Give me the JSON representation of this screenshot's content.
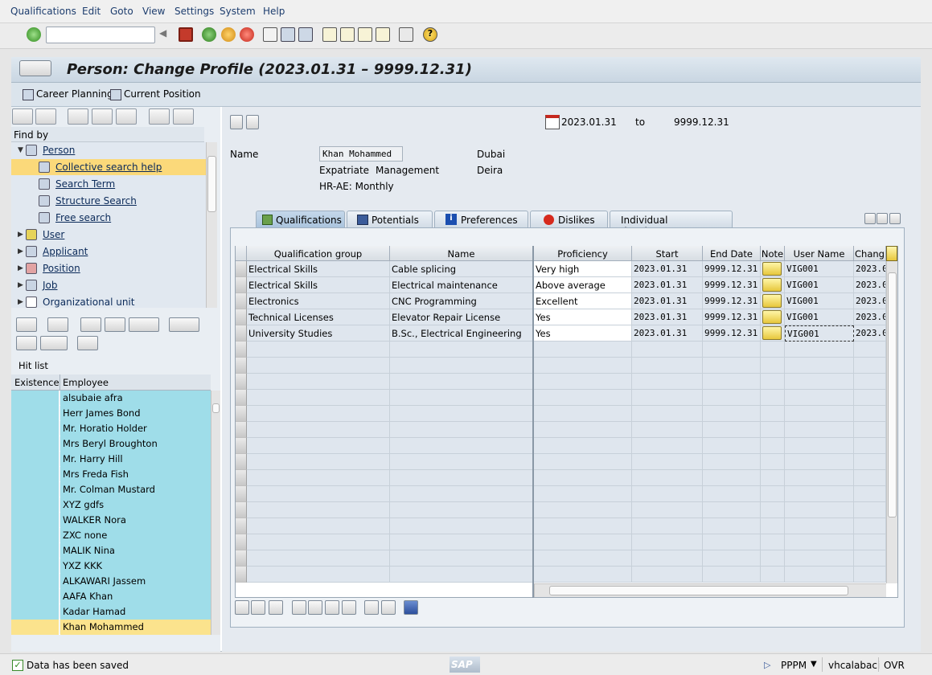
{
  "menu": [
    "Qualifications",
    "Edit",
    "Goto",
    "View",
    "Settings",
    "System",
    "Help"
  ],
  "command_field": {
    "value": "",
    "placeholder": ""
  },
  "title": "Person: Change Profile (2023.01.31 – 9999.12.31)",
  "app_toolbar": {
    "career_planning": "Career Planning",
    "current_position": "Current Position"
  },
  "left": {
    "find_by": "Find by",
    "tree": [
      {
        "label": "Person",
        "level": 0,
        "expanded": true
      },
      {
        "label": "Collective search help",
        "level": 1,
        "selected": true
      },
      {
        "label": "Search Term",
        "level": 1
      },
      {
        "label": "Structure Search",
        "level": 1
      },
      {
        "label": "Free search",
        "level": 1
      },
      {
        "label": "User",
        "level": 0
      },
      {
        "label": "Applicant",
        "level": 0
      },
      {
        "label": "Position",
        "level": 0
      },
      {
        "label": "Job",
        "level": 0
      },
      {
        "label": "Organizational unit",
        "level": 0
      }
    ],
    "hit_list_label": "Hit list",
    "hit_columns": [
      "Existence",
      "Employee"
    ],
    "hits": [
      "alsubaie afra",
      "Herr James Bond",
      "Mr. Horatio Holder",
      "Mrs Beryl Broughton",
      "Mr. Harry Hill",
      "Mrs Freda Fish",
      "Mr. Colman Mustard",
      "XYZ gdfs",
      "WALKER Nora",
      "ZXC none",
      "MALIK Nina",
      "YXZ KKK",
      "ALKAWARI Jassem",
      "AAFA Khan",
      "Kadar Hamad",
      "Khan Mohammed"
    ]
  },
  "header": {
    "date_from": "2023.01.31",
    "to_label": "to",
    "date_to": "9999.12.31",
    "name_label": "Name",
    "name_value": "Khan Mohammed",
    "location1": "Dubai",
    "location2": "Deira",
    "type1": "Expatriate",
    "type2": "Management",
    "payroll": "HR-AE: Monthly"
  },
  "tabs": [
    "Qualifications",
    "Potentials",
    "Preferences",
    "Dislikes",
    "Individual development"
  ],
  "table": {
    "columns": [
      "Qualification group",
      "Name",
      "Proficiency",
      "Start",
      "End Date",
      "Note",
      "User Name",
      "Chang"
    ],
    "rows": [
      {
        "group": "Electrical Skills",
        "name": "Cable splicing",
        "proficiency": "Very high",
        "start": "2023.01.31",
        "end": "9999.12.31",
        "user": "VIG001",
        "changed": "2023.0"
      },
      {
        "group": "Electrical Skills",
        "name": "Electrical maintenance",
        "proficiency": "Above average",
        "start": "2023.01.31",
        "end": "9999.12.31",
        "user": "VIG001",
        "changed": "2023.0"
      },
      {
        "group": "Electronics",
        "name": "CNC Programming",
        "proficiency": "Excellent",
        "start": "2023.01.31",
        "end": "9999.12.31",
        "user": "VIG001",
        "changed": "2023.0"
      },
      {
        "group": "Technical Licenses",
        "name": "Elevator Repair License",
        "proficiency": "Yes",
        "start": "2023.01.31",
        "end": "9999.12.31",
        "user": "VIG001",
        "changed": "2023.0"
      },
      {
        "group": "University Studies",
        "name": "B.Sc., Electrical Engineering",
        "proficiency": "Yes",
        "start": "2023.01.31",
        "end": "9999.12.31",
        "user": "VIG001",
        "changed": "2023.0"
      }
    ]
  },
  "status": {
    "message": "Data has been saved",
    "system": "PPPM",
    "user": "vhcalabaci",
    "mode": "OVR",
    "logo": "SAP"
  },
  "colors": {
    "accent": "#1d3d6e",
    "hit_bg": "#9fdde9",
    "selected": "#fbd97a"
  }
}
